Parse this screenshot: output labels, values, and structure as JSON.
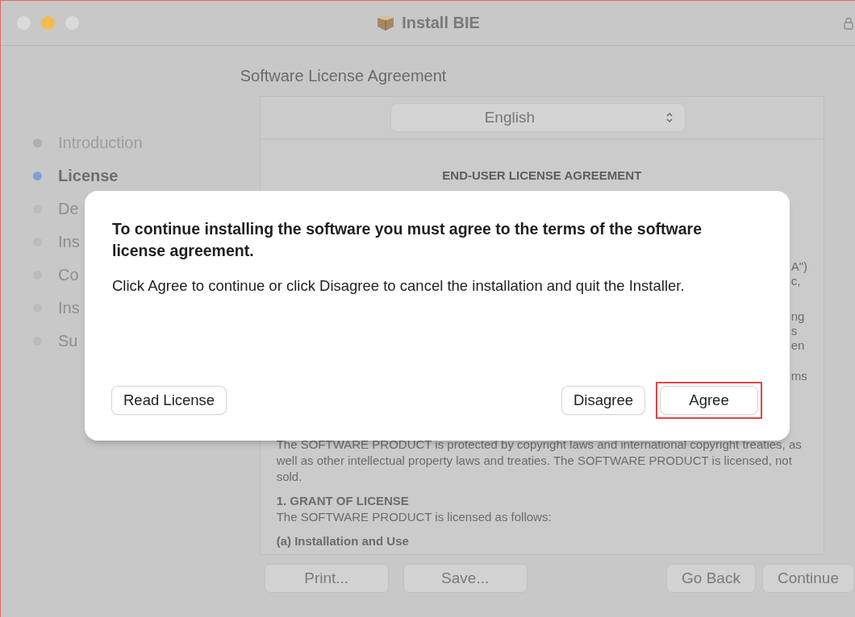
{
  "window": {
    "title": "Install BIE"
  },
  "sidebar": {
    "items": [
      {
        "label": "Introduction",
        "selected": false
      },
      {
        "label": "License",
        "selected": true
      },
      {
        "label": "De",
        "selected": false
      },
      {
        "label": "Ins",
        "selected": false
      },
      {
        "label": "Co",
        "selected": false
      },
      {
        "label": "Ins",
        "selected": false
      },
      {
        "label": "Su",
        "selected": false
      }
    ]
  },
  "page_title": "Software License Agreement",
  "language_popup": {
    "value": "English"
  },
  "license": {
    "heading": "END-USER LICENSE AGREEMENT",
    "partial_lines": [
      [
        "A\")",
        "c,"
      ],
      [
        "ng",
        "s",
        "en"
      ],
      [
        "ms"
      ]
    ],
    "paragraphs": [
      {
        "kind": "text",
        "text": "The SOFTWARE PRODUCT is protected by copyright laws and international copyright treaties, as well as other intellectual property laws and treaties. The SOFTWARE PRODUCT is licensed, not sold."
      },
      {
        "kind": "heading",
        "text": "1. GRANT OF LICENSE"
      },
      {
        "kind": "text",
        "text": "The SOFTWARE PRODUCT is licensed as follows:"
      },
      {
        "kind": "heading",
        "text": "(a) Installation and Use"
      }
    ]
  },
  "buttons_left": [
    "Print...",
    "Save..."
  ],
  "buttons_right": [
    "Go Back",
    "Continue"
  ],
  "dialog": {
    "title": "To continue installing the software you must agree to the terms of the software license agreement.",
    "message": "Click Agree to continue or click Disagree to cancel the installation and quit the Installer.",
    "left_buttons": [
      {
        "label": "Read License",
        "highlighted": false
      }
    ],
    "right_buttons": [
      {
        "label": "Disagree",
        "highlighted": false
      },
      {
        "label": "Agree",
        "highlighted": true
      }
    ]
  }
}
